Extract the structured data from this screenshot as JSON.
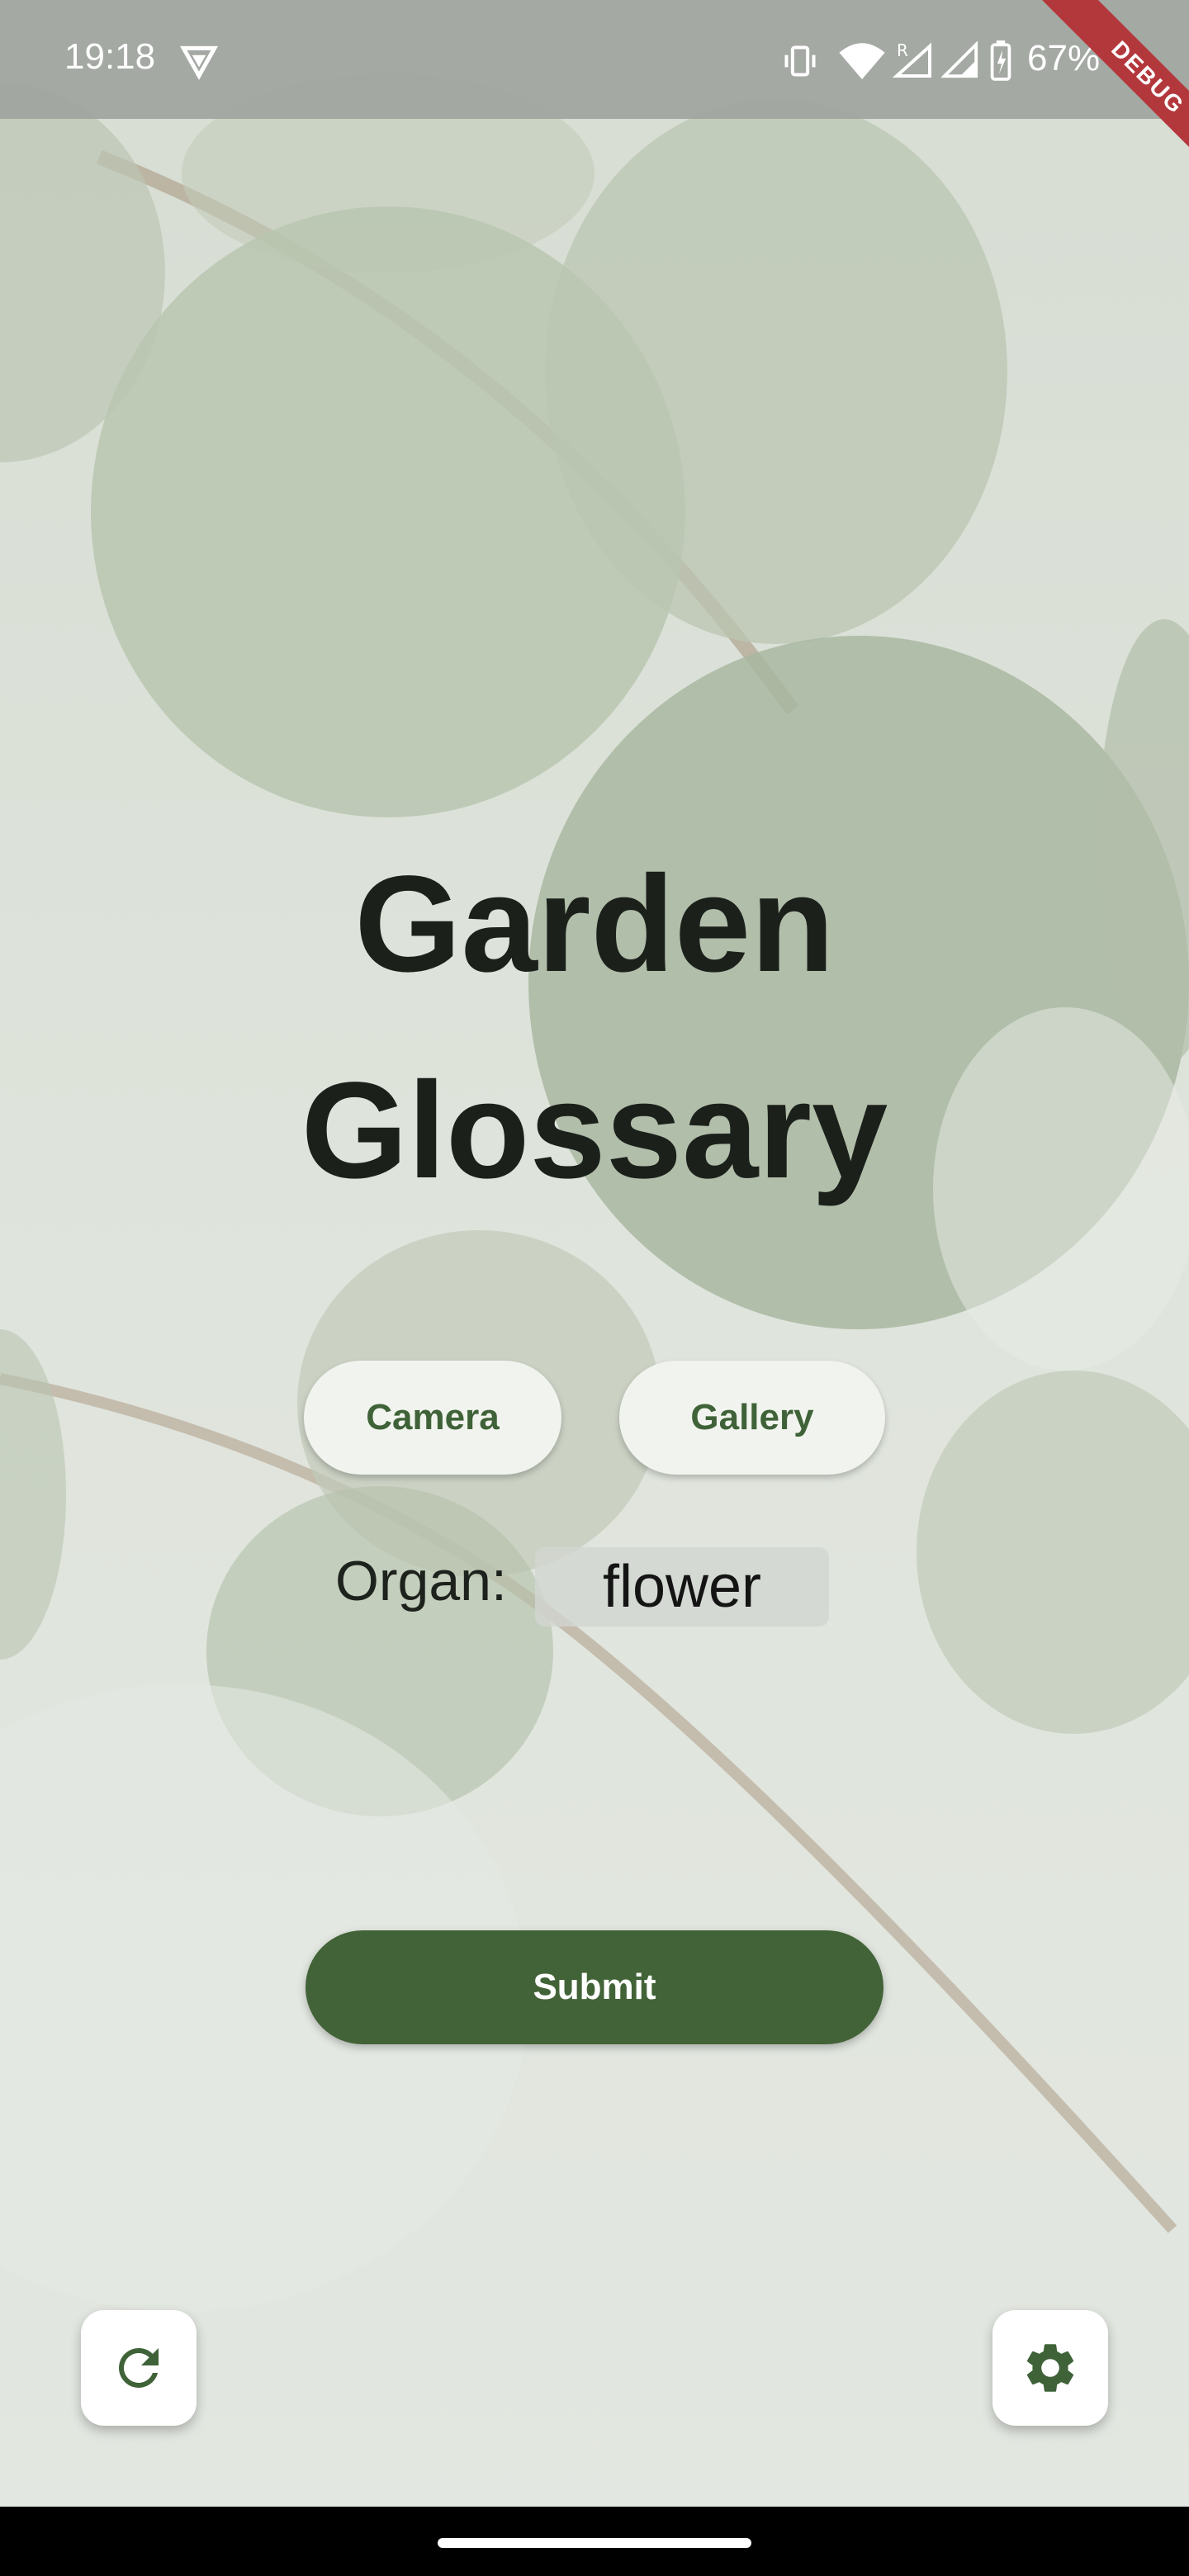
{
  "status_bar": {
    "time": "19:18",
    "battery_percent": "67%",
    "debug_label": "DEBUG",
    "icons": [
      "vpn-icon",
      "vibrate-icon",
      "wifi-icon",
      "cellular-roaming-icon",
      "cellular-icon",
      "battery-charging-icon"
    ]
  },
  "main": {
    "title_line1": "Garden",
    "title_line2": "Glossary",
    "camera_label": "Camera",
    "gallery_label": "Gallery",
    "organ_label": "Organ:",
    "organ_value": "flower",
    "submit_label": "Submit"
  },
  "fabs": {
    "refresh_icon": "refresh-icon",
    "settings_icon": "gear-icon"
  },
  "colors": {
    "primary_green": "#426337",
    "button_text_green": "#3f6238",
    "pill_background": "#f1f4ee",
    "title_color": "#1c201b",
    "debug_banner": "#b3383c"
  }
}
